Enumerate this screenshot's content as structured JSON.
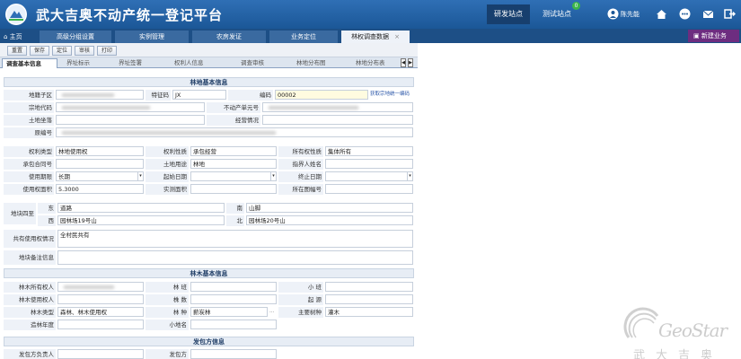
{
  "app": {
    "title": "武大吉奥不动产统一登记平台"
  },
  "header": {
    "buttons": [
      {
        "label": "研发站点",
        "active": true
      },
      {
        "label": "测试站点",
        "active": false
      }
    ],
    "notification_count": "0",
    "user_name": "陈先能"
  },
  "tabs": {
    "home_label": "主页",
    "items": [
      {
        "label": "高级分组设置"
      },
      {
        "label": "实例管理"
      },
      {
        "label": "农房发证"
      },
      {
        "label": "业务定位"
      },
      {
        "label": "林权调查数据"
      }
    ],
    "new_business_label": "新建业务"
  },
  "toolbar": {
    "buttons": [
      "重置",
      "保存",
      "定位",
      "审核",
      "打印"
    ]
  },
  "form_tabs": [
    "调查基本信息",
    "界址标示",
    "界址签署",
    "权利人信息",
    "调查审核",
    "林地分布图",
    "林地分布表"
  ],
  "colors": {
    "header": "#1b5797",
    "tabbar": "#1d4f86",
    "new_business": "#6d2d80",
    "section": "#e7edf5"
  },
  "sections": {
    "land": "林地基本信息",
    "trees": "林木基本信息",
    "contract": "发包方信息"
  },
  "land": {
    "district": {
      "label": "地籍子区",
      "value": ""
    },
    "land_code": {
      "label": "特征码",
      "value": "JX"
    },
    "serial": {
      "label": "编码",
      "value": "00002"
    },
    "fetch_link": "获取宗地统一编码",
    "parcel_code": {
      "label": "宗地代码",
      "value": ""
    },
    "unit_no": {
      "label": "不动产单元号",
      "value": ""
    },
    "location": {
      "label": "土地坐落",
      "value": ""
    },
    "operation": {
      "label": "经营情况",
      "value": ""
    },
    "seq": {
      "label": "原编号",
      "value": ""
    },
    "right_type": {
      "label": "权利类型",
      "value": "林地使用权"
    },
    "right_nature": {
      "label": "权利性质",
      "value": "承包经营"
    },
    "owner_nature": {
      "label": "所有权性质",
      "value": "集体所有"
    },
    "contract_no": {
      "label": "承包合同号",
      "value": ""
    },
    "land_use": {
      "label": "土地用途",
      "value": "林地"
    },
    "surveyor": {
      "label": "指界人姓名",
      "value": ""
    },
    "term": {
      "label": "使用期限",
      "value": "长期"
    },
    "start_date": {
      "label": "起始日期",
      "value": ""
    },
    "end_date": {
      "label": "终止日期",
      "value": ""
    },
    "area": {
      "label": "使用权面积",
      "value": "5.3000"
    },
    "actual_area": {
      "label": "实测面积",
      "value": ""
    },
    "map_no": {
      "label": "所在图幅号",
      "value": ""
    },
    "boundary": {
      "label": "地块四至",
      "east_label": "东",
      "east": "道路",
      "south_label": "南",
      "south": "山脚",
      "west_label": "西",
      "west": "园林场19号山",
      "north_label": "北",
      "north": "园林场20号山"
    },
    "shared": {
      "label": "共有使用权情况",
      "value": "全村民共有"
    },
    "note": {
      "label": "地块备注信息",
      "value": ""
    }
  },
  "trees": {
    "owner": {
      "label": "林木所有权人",
      "value": ""
    },
    "forest_class": {
      "label": "林 班",
      "value": ""
    },
    "small_class": {
      "label": "小 班",
      "value": ""
    },
    "user": {
      "label": "林木使用权人",
      "value": ""
    },
    "count": {
      "label": "株 数",
      "value": ""
    },
    "origin": {
      "label": "起 源",
      "value": ""
    },
    "tree_type": {
      "label": "林木类型",
      "value": "森林、林木使用权"
    },
    "forest_kind": {
      "label": "林 种",
      "value": "薪炭林"
    },
    "main_species": {
      "label": "主要树种",
      "value": "灌木"
    },
    "year": {
      "label": "造林年度",
      "value": ""
    },
    "place": {
      "label": "小地名",
      "value": ""
    }
  },
  "contract": {
    "contractor": {
      "label": "发包方负责人",
      "value": ""
    },
    "name": {
      "label": "发包方",
      "value": ""
    }
  },
  "watermark": {
    "brand": "GeoStar",
    "cn": "武大吉奥"
  }
}
